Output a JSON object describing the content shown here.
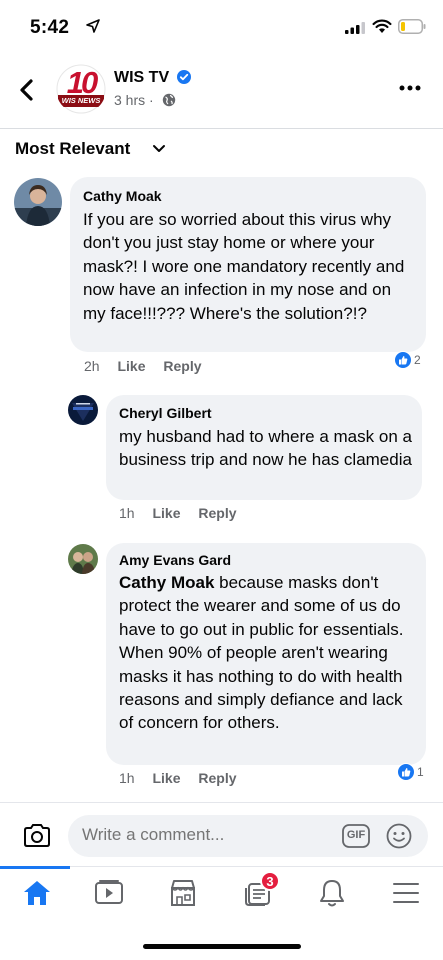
{
  "status_bar": {
    "time": "5:42"
  },
  "header": {
    "page_name": "WIS TV",
    "logo_text": "10",
    "logo_sub": "WIS NEWS",
    "timestamp": "3 hrs ·"
  },
  "sort": {
    "label": "Most Relevant"
  },
  "comments": [
    {
      "author": "Cathy Moak",
      "text": "If you are so worried about this virus why don't you just stay home or where your mask?! I wore one mandatory recently and now have an infection in my nose and on my face!!!??? Where's the solution?!?",
      "time": "2h",
      "like": "Like",
      "reply": "Reply",
      "reaction_count": "2"
    },
    {
      "author": "Cheryl Gilbert",
      "text": "my husband had to where a mask on a business trip and now he has clamedia",
      "time": "1h",
      "like": "Like",
      "reply": "Reply"
    },
    {
      "author": "Amy Evans Gard",
      "mention": "Cathy Moak",
      "text": " because masks don't protect the wearer and some of us do have to go out in public for essentials. When 90% of people aren't wearing masks it has nothing to do with health reasons and simply defiance and lack of concern for others.",
      "time": "1h",
      "like": "Like",
      "reply": "Reply",
      "reaction_count": "1"
    }
  ],
  "composer": {
    "placeholder": "Write a comment...",
    "gif_label": "GIF"
  },
  "tabbar": {
    "notification_badge": "3"
  },
  "colors": {
    "accent": "#1877f2",
    "bubble": "#f0f2f5",
    "secondary_text": "#65676b",
    "badge": "#e41e3f"
  }
}
